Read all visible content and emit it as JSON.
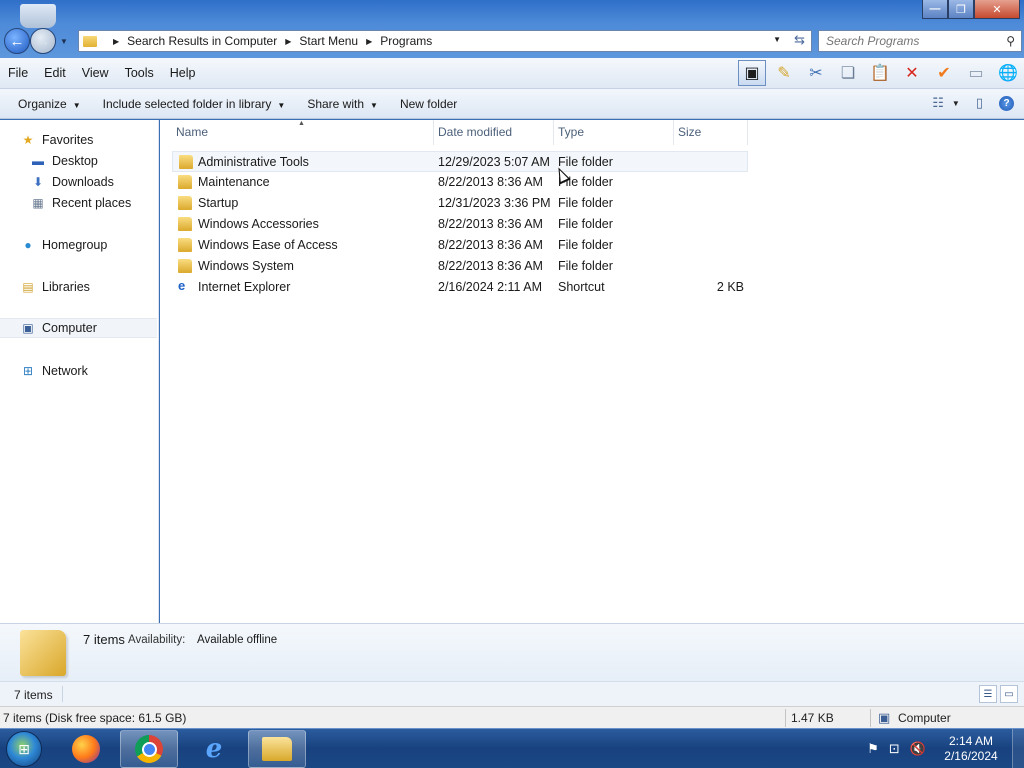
{
  "window": {
    "controls": {
      "minimize": "—",
      "maximize": "❐",
      "close": "✕"
    }
  },
  "address": {
    "crumbs": [
      "Search Results in Computer",
      "Start Menu",
      "Programs"
    ],
    "separator": "▶"
  },
  "search": {
    "placeholder": "Search Programs"
  },
  "menubar": {
    "items": [
      "File",
      "Edit",
      "View",
      "Tools",
      "Help"
    ]
  },
  "commandbar": {
    "organize": "Organize",
    "include": "Include selected folder in library",
    "share": "Share with",
    "new_folder": "New folder"
  },
  "navpane": {
    "favorites": "Favorites",
    "desktop": "Desktop",
    "downloads": "Downloads",
    "recent": "Recent places",
    "homegroup": "Homegroup",
    "libraries": "Libraries",
    "computer": "Computer",
    "network": "Network"
  },
  "columns": {
    "name": "Name",
    "date": "Date modified",
    "type": "Type",
    "size": "Size"
  },
  "files": [
    {
      "name": "Administrative Tools",
      "date": "12/29/2023 5:07 AM",
      "type": "File folder",
      "size": "",
      "icon": "folder-icon"
    },
    {
      "name": "Maintenance",
      "date": "8/22/2013 8:36 AM",
      "type": "File folder",
      "size": "",
      "icon": "folder-icon"
    },
    {
      "name": "Startup",
      "date": "12/31/2023 3:36 PM",
      "type": "File folder",
      "size": "",
      "icon": "folder-icon"
    },
    {
      "name": "Windows Accessories",
      "date": "8/22/2013 8:36 AM",
      "type": "File folder",
      "size": "",
      "icon": "folder-icon"
    },
    {
      "name": "Windows Ease of Access",
      "date": "8/22/2013 8:36 AM",
      "type": "File folder",
      "size": "",
      "icon": "folder-icon"
    },
    {
      "name": "Windows System",
      "date": "8/22/2013 8:36 AM",
      "type": "File folder",
      "size": "",
      "icon": "folder-icon"
    },
    {
      "name": "Internet Explorer",
      "date": "2/16/2024 2:11 AM",
      "type": "Shortcut",
      "size": "2 KB",
      "icon": "ie-shortcut-icon"
    }
  ],
  "details": {
    "count": "7 items",
    "availability_label": "Availability:",
    "availability_value": "Available offline"
  },
  "status": {
    "strip_count": "7 items",
    "left": "7 items (Disk free space: 61.5 GB)",
    "size": "1.47 KB",
    "location": "Computer"
  },
  "taskbar": {
    "time": "2:14 AM",
    "date": "2/16/2024",
    "colors": {
      "bar": "#18427f",
      "accent": "#2b5c9e"
    }
  }
}
